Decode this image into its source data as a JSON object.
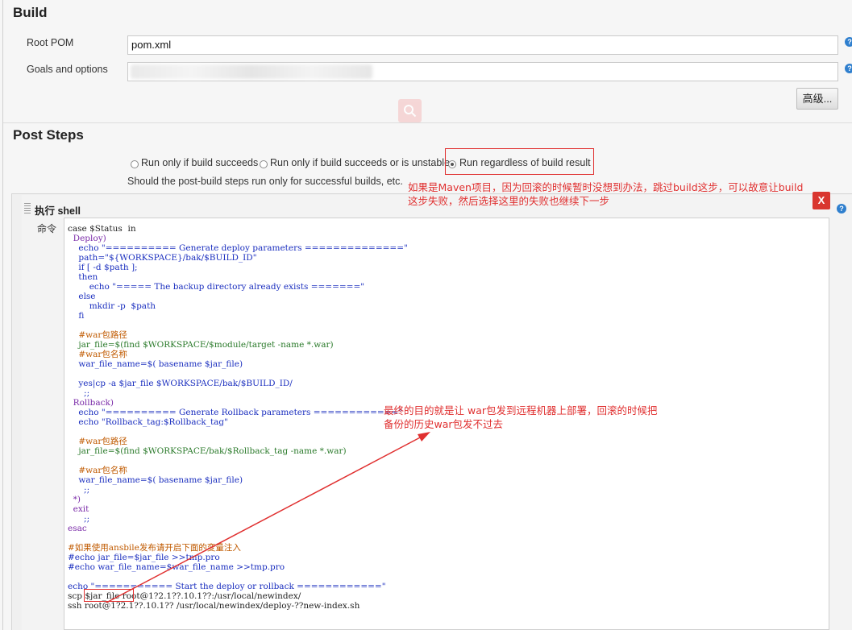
{
  "build": {
    "title": "Build",
    "root_pom_label": "Root POM",
    "root_pom_value": "pom.xml",
    "goals_label": "Goals and options",
    "advanced_button": "高级..."
  },
  "post_steps": {
    "title": "Post Steps",
    "options": [
      {
        "label": "Run only if build succeeds",
        "selected": false
      },
      {
        "label": "Run only if build succeeds or is unstable",
        "selected": false
      },
      {
        "label": "Run regardless of build result",
        "selected": true
      }
    ],
    "description": "Should the post-build steps run only for successful builds, etc."
  },
  "annotations": {
    "note1_line1": "如果是Maven项目，因为回滚的时候暂时没想到办法，跳过build这步，可以故意让build",
    "note1_line2": "这步失败，然后选择这里的失败也继续下一步",
    "note2_line1": "最终的目的就是让 war包发到远程机器上部署，回滚的时候把",
    "note2_line2": "备份的历史war包发不过去"
  },
  "shell": {
    "title": "执行 shell",
    "delete_label": "X",
    "command_label": "命令",
    "lines": [
      "case $Status  in",
      "  Deploy)",
      "    echo \"========== Generate deploy parameters ==============\"",
      "    path=\"${WORKSPACE}/bak/$BUILD_ID\"",
      "    if [ -d $path ];",
      "    then",
      "        echo \"===== The backup directory already exists =======\"",
      "    else",
      "        mkdir -p  $path",
      "    fi",
      "",
      "    #war包路径",
      "    jar_file=$(find $WORKSPACE/$module/target -name *.war)",
      "    #war包名称",
      "    war_file_name=$( basename $jar_file)",
      "",
      "    yes|cp -a $jar_file $WORKSPACE/bak/$BUILD_ID/",
      "      ;;",
      "  Rollback)",
      "    echo \"========== Generate Rollback parameters ============\"",
      "    echo \"Rollback_tag:$Rollback_tag\"",
      "",
      "    #war包路径",
      "    jar_file=$(find $WORKSPACE/bak/$Rollback_tag -name *.war)",
      "",
      "    #war包名称",
      "    war_file_name=$( basename $jar_file)",
      "      ;;",
      "  *)",
      "  exit",
      "      ;;",
      "esac",
      "",
      "#如果使用ansbile发布请开启下面的变量注入",
      "#echo jar_file=$jar_file >>tmp.pro",
      "#echo war_file_name=$war_file_name >>tmp.pro",
      "",
      "echo \"=========== Start the deploy or rollback ============\"",
      "scp $jar_file root@1?2.1??.10.1??:/usr/local/newindex/",
      "ssh root@1?2.1??.10.1?? /usr/local/newindex/deploy-??new-index.sh"
    ],
    "line_colors": [
      "default",
      "purple",
      "blue",
      "blue",
      "blue",
      "blue",
      "blue",
      "blue",
      "blue",
      "blue",
      "default",
      "orange",
      "green",
      "orange",
      "blue",
      "default",
      "blue",
      "blue",
      "purple",
      "blue",
      "blue",
      "default",
      "orange",
      "green",
      "default",
      "orange",
      "blue",
      "blue",
      "purple",
      "purple",
      "blue",
      "purple",
      "default",
      "orange",
      "blue",
      "blue",
      "default",
      "blue",
      "default",
      "default"
    ]
  }
}
